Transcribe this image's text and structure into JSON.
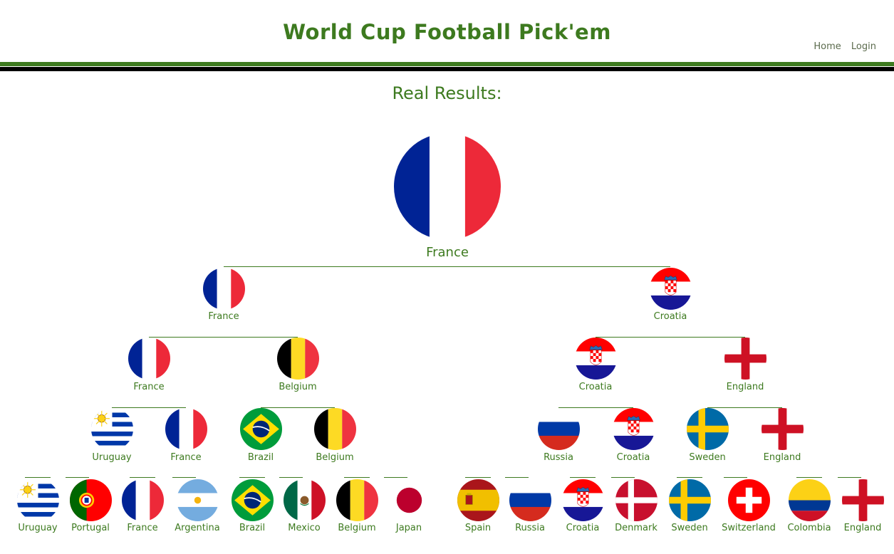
{
  "header": {
    "title": "World Cup Football Pick'em",
    "nav": {
      "home": "Home",
      "login": "Login"
    }
  },
  "results_title": "Real Results:",
  "champion": {
    "name": "France",
    "flag": "france-flag"
  },
  "semifinal": [
    {
      "name": "France",
      "flag": "france-flag"
    },
    {
      "name": "Croatia",
      "flag": "croatia-flag"
    }
  ],
  "quarterfinal": [
    {
      "name": "France",
      "flag": "france-flag"
    },
    {
      "name": "Belgium",
      "flag": "belgium-flag"
    },
    {
      "name": "Croatia",
      "flag": "croatia-flag"
    },
    {
      "name": "England",
      "flag": "england-flag"
    }
  ],
  "round16": [
    {
      "name": "Uruguay",
      "flag": "uruguay-flag"
    },
    {
      "name": "France",
      "flag": "france-flag"
    },
    {
      "name": "Brazil",
      "flag": "brazil-flag"
    },
    {
      "name": "Belgium",
      "flag": "belgium-flag"
    },
    {
      "name": "Russia",
      "flag": "russia-flag"
    },
    {
      "name": "Croatia",
      "flag": "croatia-flag"
    },
    {
      "name": "Sweden",
      "flag": "sweden-flag"
    },
    {
      "name": "England",
      "flag": "england-flag"
    }
  ],
  "round32": [
    {
      "name": "Uruguay",
      "flag": "uruguay-flag"
    },
    {
      "name": "Portugal",
      "flag": "portugal-flag"
    },
    {
      "name": "France",
      "flag": "france-flag"
    },
    {
      "name": "Argentina",
      "flag": "argentina-flag"
    },
    {
      "name": "Brazil",
      "flag": "brazil-flag"
    },
    {
      "name": "Mexico",
      "flag": "mexico-flag"
    },
    {
      "name": "Belgium",
      "flag": "belgium-flag"
    },
    {
      "name": "Japan",
      "flag": "japan-flag"
    },
    {
      "name": "Spain",
      "flag": "spain-flag"
    },
    {
      "name": "Russia",
      "flag": "russia-flag"
    },
    {
      "name": "Croatia",
      "flag": "croatia-flag"
    },
    {
      "name": "Denmark",
      "flag": "denmark-flag"
    },
    {
      "name": "Sweden",
      "flag": "sweden-flag"
    },
    {
      "name": "Switzerland",
      "flag": "switzerland-flag"
    },
    {
      "name": "Colombia",
      "flag": "colombia-flag"
    },
    {
      "name": "England",
      "flag": "england-flag"
    }
  ],
  "colors": {
    "accent": "#3d7a1f",
    "rule": "#000000"
  }
}
